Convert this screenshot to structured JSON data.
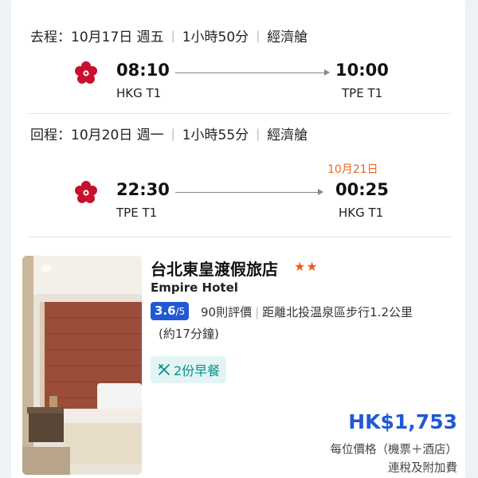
{
  "outbound": {
    "label": "去程：",
    "date": "10月17日 週五",
    "duration": "1小時50分",
    "cabin": "經濟艙",
    "dep_time": "08:10",
    "dep_airport": "HKG T1",
    "arr_time": "10:00",
    "arr_airport": "TPE T1",
    "airline_icon": "plum-blossom-airline-logo"
  },
  "return": {
    "label": "回程：",
    "date": "10月20日 週一",
    "duration": "1小時55分",
    "cabin": "經濟艙",
    "dep_time": "22:30",
    "dep_airport": "TPE T1",
    "arr_time": "00:25",
    "arr_airport": "HKG T1",
    "arrival_date_note": "10月21日",
    "airline_icon": "plum-blossom-airline-logo"
  },
  "hotel": {
    "name_zh": "台北東皇渡假旅店",
    "star_rating": "★★",
    "name_en": "Empire Hotel",
    "score": "3.6",
    "score_out_of": "/5",
    "reviews": "90則評價",
    "distance": "距離北投温泉區步行1.2公里",
    "walk_time": "(約17分鐘)",
    "breakfast": "2份早餐",
    "breakfast_icon": "utensils-icon",
    "price": "HK$1,753",
    "price_note": "每位價格（機票＋酒店）",
    "price_note2": "連稅及附加費"
  },
  "colors": {
    "accent_blue": "#2158d4",
    "next_day_orange": "#e5691e",
    "star_orange": "#e8601c",
    "breakfast_teal": "#0a8f8a",
    "breakfast_bg": "#e2f5f4"
  }
}
